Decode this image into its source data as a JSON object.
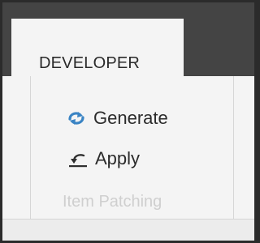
{
  "tab": {
    "label": "DEVELOPER"
  },
  "group": {
    "label": "Item Patching",
    "buttons": [
      {
        "label": "Generate",
        "icon": "generate-sync-icon"
      },
      {
        "label": "Apply",
        "icon": "apply-undo-icon"
      }
    ]
  },
  "colors": {
    "window_dark": "#444444",
    "ribbon_bg": "#f4f4f4",
    "icon_blue": "#3a84c4",
    "text": "#2b2b2b",
    "group_label": "#cfcfcf"
  }
}
